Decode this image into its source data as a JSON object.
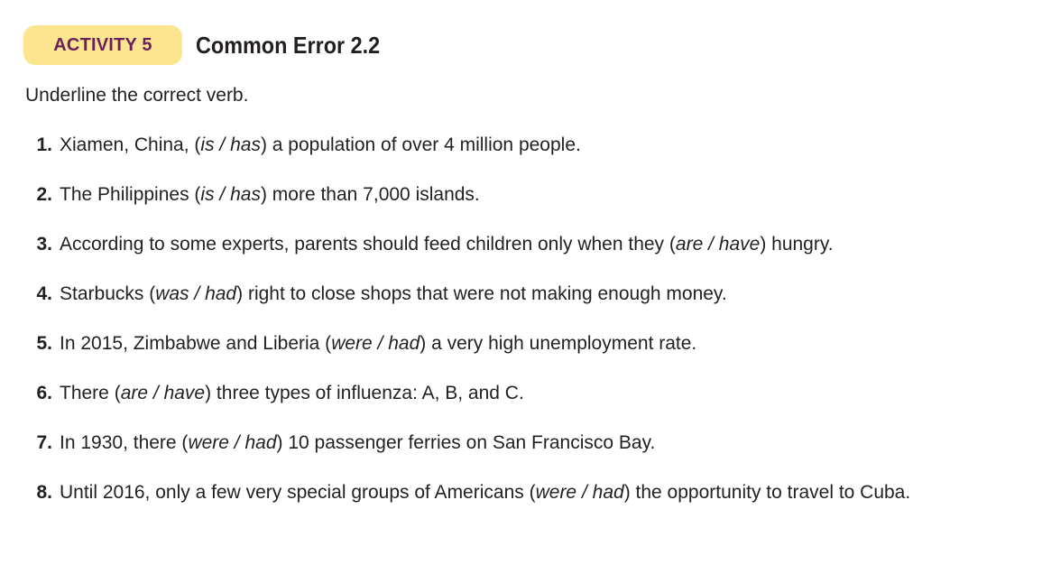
{
  "header": {
    "badge_label": "ACTIVITY 5",
    "title": "Common Error 2.2"
  },
  "instruction": "Underline the correct verb.",
  "items": [
    {
      "num": "1.",
      "before": "Xiamen, China, (",
      "opt1": "is",
      "opt2": "has",
      "after": ") a population of over 4 million people."
    },
    {
      "num": "2.",
      "before": "The Philippines (",
      "opt1": "is",
      "opt2": "has",
      "after": ") more than 7,000 islands."
    },
    {
      "num": "3.",
      "before": "According to some experts, parents should feed children only when they (",
      "opt1": "are",
      "opt2": "have",
      "after": ") hungry."
    },
    {
      "num": "4.",
      "before": "Starbucks (",
      "opt1": "was",
      "opt2": "had",
      "after": ") right to close shops that were not making enough money."
    },
    {
      "num": "5.",
      "before": "In 2015, Zimbabwe and Liberia (",
      "opt1": "were",
      "opt2": "had",
      "after": ") a very high unemployment rate."
    },
    {
      "num": "6.",
      "before": "There (",
      "opt1": "are",
      "opt2": "have",
      "after": ") three types of influenza: A, B, and C."
    },
    {
      "num": "7.",
      "before": "In 1930, there (",
      "opt1": "were",
      "opt2": "had",
      "after": ") 10 passenger ferries on San Francisco Bay."
    },
    {
      "num": "8.",
      "before": "Until 2016, only a few very special groups of Americans (",
      "opt1": "were",
      "opt2": "had",
      "after": ") the opportunity to travel to Cuba."
    }
  ],
  "colors": {
    "badge_background": "#fbe68f",
    "badge_text": "#6b1f5c",
    "body_text": "#231f20"
  }
}
